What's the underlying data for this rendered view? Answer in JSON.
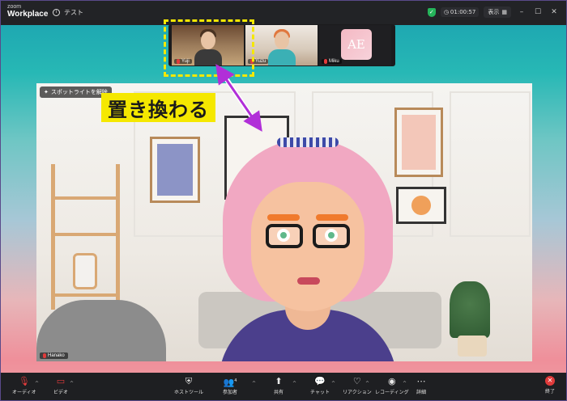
{
  "titlebar": {
    "logo_small": "zoom",
    "logo_big": "Workplace",
    "meeting_name": "テスト",
    "timer": "01:00:57",
    "view_label": "表示"
  },
  "participants": [
    {
      "name": "Yuji"
    },
    {
      "name": "Yuzu"
    },
    {
      "name": "Miku",
      "initials": "AE"
    }
  ],
  "main_video": {
    "spotlight_label": "スポットライトを解除",
    "speaker_name": "Hanako"
  },
  "annotation": {
    "replace_label": "置き換わる",
    "accent_yellow": "#f5e800",
    "arrow_color": "#b12fd8"
  },
  "toolbar": {
    "audio": "オーディオ",
    "video": "ビデオ",
    "host_tools": "ホストツール",
    "participants": "参加者",
    "participants_count": "4",
    "share": "共有",
    "chat": "チャット",
    "reactions": "リアクション",
    "recording": "レコーディング",
    "more": "詳細",
    "end": "終了"
  }
}
